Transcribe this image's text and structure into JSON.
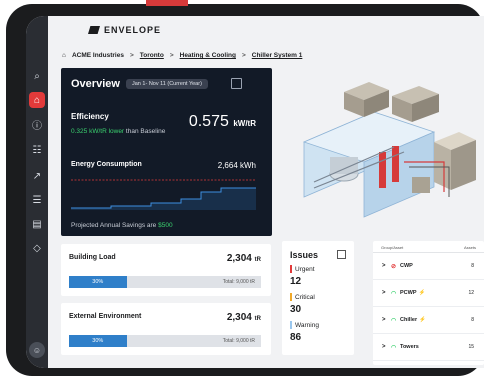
{
  "app": {
    "brand": "ENVELOPE"
  },
  "breadcrumb": [
    "ACME Industries",
    "Toronto",
    "Heating & Cooling",
    "Chiller System 1"
  ],
  "overview": {
    "title": "Overview",
    "date_range": "Jan 1- Nov 11 (Current Year)",
    "efficiency_label": "Efficiency",
    "efficiency_value": "0.575",
    "efficiency_unit": "kW/tR",
    "efficiency_delta": "0.325 kW/tR lower",
    "efficiency_suffix": "than Baseline",
    "energy_label": "Energy Consumption",
    "energy_value": "2,664 kWh",
    "savings_text": "Projected Annual Savings are",
    "savings_value": "$500"
  },
  "building_load": {
    "title": "Building Load",
    "value": "2,304",
    "unit": "tR",
    "percent_label": "30%",
    "percent": 0.3,
    "total": "Total: 9,000 tR"
  },
  "external_env": {
    "title": "External Environment",
    "value": "2,304",
    "unit": "tR",
    "percent_label": "30%",
    "percent": 0.3,
    "total": "Total: 9,000 tR"
  },
  "issues": {
    "title": "Issues",
    "items": [
      {
        "label": "Urgent",
        "count": "12",
        "color": "#e23a3a"
      },
      {
        "label": "Critical",
        "count": "30",
        "color": "#f0a92a"
      },
      {
        "label": "Warning",
        "count": "86",
        "color": "#9ac7ee"
      }
    ]
  },
  "assets": {
    "col_group": "Group/Asset",
    "col_assets": "Assets",
    "rows": [
      {
        "name": "CWP",
        "count": "8",
        "icon": "no-flow-icon",
        "bolt": ""
      },
      {
        "name": "PCWP",
        "count": "12",
        "icon": "wifi-icon",
        "bolt": "⚡"
      },
      {
        "name": "Chiller",
        "count": "8",
        "icon": "wifi-icon",
        "bolt": "⚡"
      },
      {
        "name": "Towers",
        "count": "15",
        "icon": "wifi-icon",
        "bolt": ""
      }
    ]
  },
  "colors": {
    "accent": "#e23a3a",
    "panel": "#121a27",
    "bar": "#2f7fc9",
    "green": "#3bd16f"
  }
}
